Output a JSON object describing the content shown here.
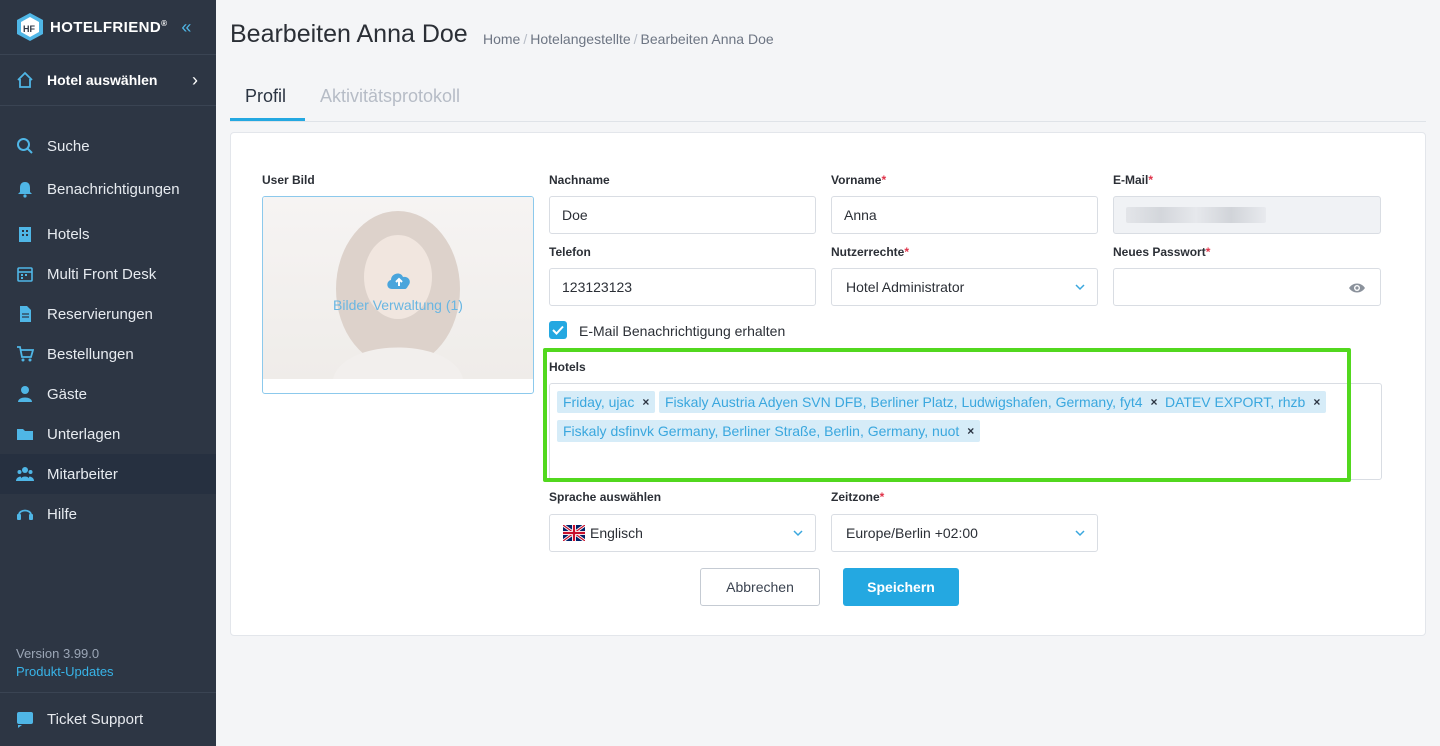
{
  "sidebar": {
    "brand": "HOTELFRIEND",
    "brand_mark": "®",
    "hotel_select": "Hotel auswählen",
    "items": [
      {
        "label": "Suche",
        "icon": "search-icon"
      },
      {
        "label": "Benachrichtigungen",
        "icon": "bell-icon"
      },
      {
        "label": "Hotels",
        "icon": "building-icon"
      },
      {
        "label": "Multi Front Desk",
        "icon": "calendar-icon"
      },
      {
        "label": "Reservierungen",
        "icon": "document-icon"
      },
      {
        "label": "Bestellungen",
        "icon": "cart-icon"
      },
      {
        "label": "Gäste",
        "icon": "user-icon"
      },
      {
        "label": "Unterlagen",
        "icon": "folder-icon"
      },
      {
        "label": "Mitarbeiter",
        "icon": "team-icon"
      },
      {
        "label": "Hilfe",
        "icon": "headset-icon"
      }
    ],
    "version": "Version 3.99.0",
    "updates_link": "Produkt-Updates",
    "ticket": "Ticket Support"
  },
  "header": {
    "title": "Bearbeiten Anna Doe",
    "breadcrumb": [
      "Home",
      "Hotelangestellte",
      "Bearbeiten Anna Doe"
    ]
  },
  "tabs": [
    {
      "label": "Profil",
      "active": true
    },
    {
      "label": "Aktivitätsprotokoll",
      "active": false
    }
  ],
  "form": {
    "user_bild_label": "User Bild",
    "image_manage": "Bilder Verwaltung (1)",
    "nachname_label": "Nachname",
    "nachname_value": "Doe",
    "vorname_label": "Vorname",
    "vorname_value": "Anna",
    "email_label": "E-Mail",
    "telefon_label": "Telefon",
    "telefon_value": "123123123",
    "rights_label": "Nutzerrechte",
    "rights_value": "Hotel Administrator",
    "password_label": "Neues Passwort",
    "email_notify": "E-Mail Benachrichtigung erhalten",
    "email_notify_checked": true,
    "hotels_label": "Hotels",
    "hotels": [
      "Friday, ujac",
      "Fiskaly Austria Adyen SVN DFB, Berliner Platz, Ludwigshafen, Germany, fyt4",
      "DATEV EXPORT, rhzb",
      "Fiskaly dsfinvk Germany, Berliner Straße, Berlin, Germany, nuot"
    ],
    "language_label": "Sprache auswählen",
    "language_value": "Englisch",
    "timezone_label": "Zeitzone",
    "timezone_value": "Europe/Berlin +02:00",
    "required_mark": "*",
    "cancel": "Abbrechen",
    "save": "Speichern"
  },
  "colors": {
    "accent": "#24a8e1",
    "sidebar": "#2d3644",
    "highlight": "#52d81e",
    "required": "#e0344a"
  }
}
